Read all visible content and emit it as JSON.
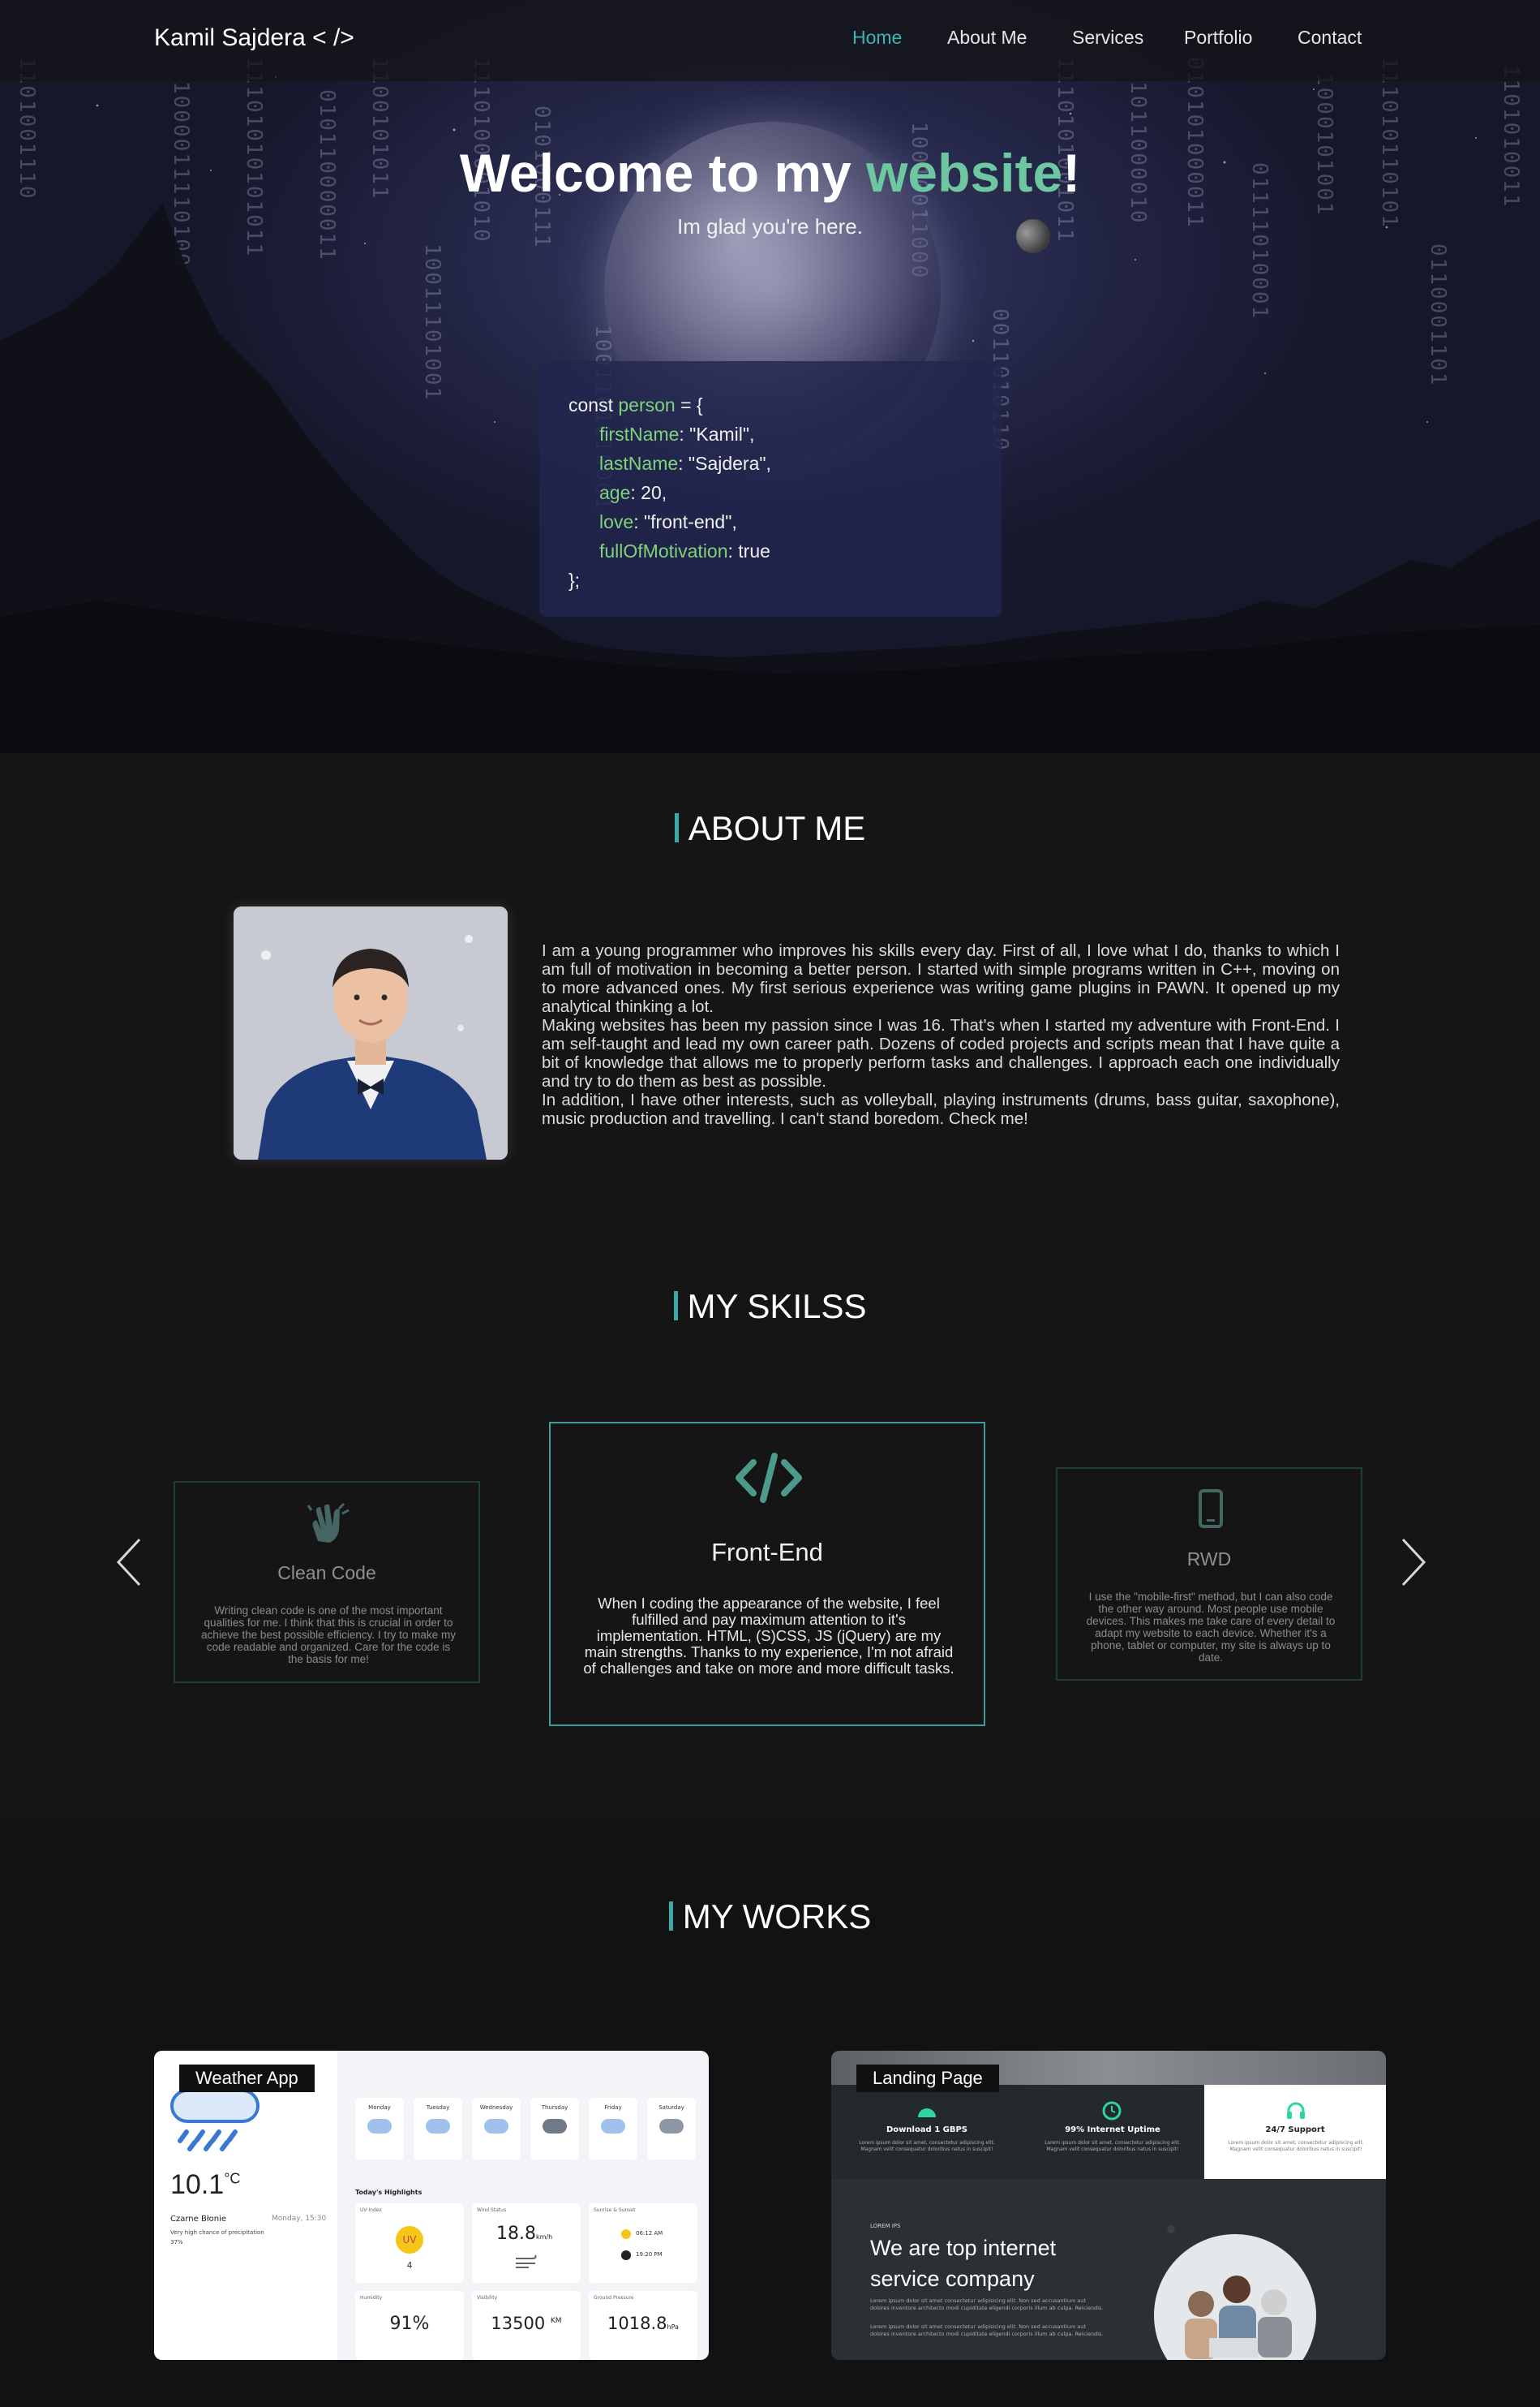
{
  "navbar": {
    "brand": "Kamil Sajdera < />",
    "items": [
      {
        "label": "Home",
        "active": true
      },
      {
        "label": "About Me",
        "active": false
      },
      {
        "label": "Services",
        "active": false
      },
      {
        "label": "Portfolio",
        "active": false
      },
      {
        "label": "Contact",
        "active": false
      }
    ]
  },
  "hero": {
    "title_prefix": "Welcome to my ",
    "title_accent": "website",
    "title_suffix": "!",
    "subtitle": "Im glad you're here.",
    "code": {
      "line_open_kw": "const ",
      "line_open_var": "person",
      "line_open_rest": " = {",
      "props": [
        {
          "key": "firstName",
          "value": ": \"Kamil\","
        },
        {
          "key": "lastName",
          "value": ": \"Sajdera\","
        },
        {
          "key": "age",
          "value": ": 20,"
        },
        {
          "key": "love",
          "value": ": \"front-end\","
        },
        {
          "key": "fullOfMotivation",
          "value": ": true"
        }
      ],
      "line_close": "};"
    },
    "binary": [
      "1101001110",
      "1000011110100",
      "11101010101011",
      "010110000011",
      "1100101011",
      "10011101001",
      "1110100001010",
      "0101000111",
      "1001101010001",
      "10010011000",
      "0011010110",
      "1110101001011",
      "1011000010",
      "010101000011",
      "01111010001",
      "1000101001",
      "111010110101",
      "0110001101",
      "1101010011"
    ]
  },
  "about": {
    "title": "ABOUT ME",
    "paragraphs": [
      "I am a young programmer who improves his skills every day. First of all, I love what I do, thanks to which I am full of motivation in becoming a better person. I started with simple programs written in C++, moving on to more advanced ones. My first serious experience was writing game plugins in PAWN. It opened up my analytical thinking a lot.",
      "Making websites has been my passion since I was 16. That's when I started my adventure with Front-End. I am self-taught and lead my own career path. Dozens of coded projects and scripts mean that I have quite a bit of knowledge that allows me to properly perform tasks and challenges. I approach each one individually and try to do them as best as possible.",
      "In addition, I have other interests, such as volleyball, playing instruments (drums, bass guitar, saxophone), music production and travelling. I can't stand boredom. Check me!"
    ]
  },
  "skills": {
    "title": "MY SKILSS",
    "left": {
      "icon": "clapping-hands-icon",
      "title": "Clean Code",
      "desc": "Writing clean code is one of the most important qualities for me. I think that this is crucial in order to achieve the best possible efficiency. I try to make my code readable and organized. Care for the code is the basis for me!"
    },
    "center": {
      "icon": "code-icon",
      "title": "Front-End",
      "desc": "When I coding the appearance of the website, I feel fulfilled and pay maximum attention to it's implementation. HTML, (S)CSS, JS (jQuery) are my main strengths. Thanks to my experience, I'm not afraid of challenges and take on more and more difficult tasks."
    },
    "right": {
      "icon": "mobile-phone-icon",
      "title": "RWD",
      "desc": "I use the \"mobile-first\" method, but I can also code the other way around. Most people use mobile devices. This makes me take care of every detail to adapt my website to each device. Whether it's a phone, tablet or computer, my site is always up to date."
    }
  },
  "works": {
    "title": "MY WORKS",
    "items": [
      {
        "label": "Weather App",
        "temp": "10.1",
        "temp_unit": "°C",
        "city": "Czarne Błonie",
        "date": "Monday, 15:30",
        "rain_note": "Very high chance of precipitation",
        "rain_pct": "37%",
        "days": [
          "Monday",
          "Tuesday",
          "Wednesday",
          "Thursday",
          "Friday",
          "Saturday"
        ],
        "highlights_title": "Today's Highlights",
        "hl_labels": [
          "UV Index",
          "Wind Status",
          "Sunrise & Sunset",
          "Humidity",
          "Visibility",
          "Ground Pressure"
        ],
        "uv_label": "UV",
        "uv_value": "4",
        "wind": "18.8",
        "wind_unit": "km/h",
        "sunrise": "06:12 AM",
        "sunset": "19:20 PM",
        "humidity": "91%",
        "visibility": "13500",
        "visibility_unit": "KM",
        "pressure": "1018.8",
        "pressure_unit": "hPa"
      },
      {
        "label": "Landing Page",
        "features": [
          {
            "icon": "speedometer-icon",
            "title": "Download 1 GBPS"
          },
          {
            "icon": "clock-icon",
            "title": "99% Internet Uptime"
          },
          {
            "icon": "headset-icon",
            "title": "24/7 Support"
          }
        ],
        "feature_text": "Lorem ipsum dolor sit amet, consectetur adipiscing elit. Magnam velit consequatur doloribus natus in suscipit!",
        "eyebrow": "LOREM IPS",
        "headline_1": "We are top internet",
        "headline_2": "service company",
        "body": "Lorem ipsum dolor sit amet consectetur adipisicing elit. Non sed accusantium aut dolores inventore architecto modi cupiditate eligendi corporis illum ab culpa. Reiciendis."
      }
    ]
  },
  "colors": {
    "accent": "#3cb4b4",
    "green": "#6dc7a0",
    "code_key": "#7fd37a",
    "bg": "#151516"
  }
}
